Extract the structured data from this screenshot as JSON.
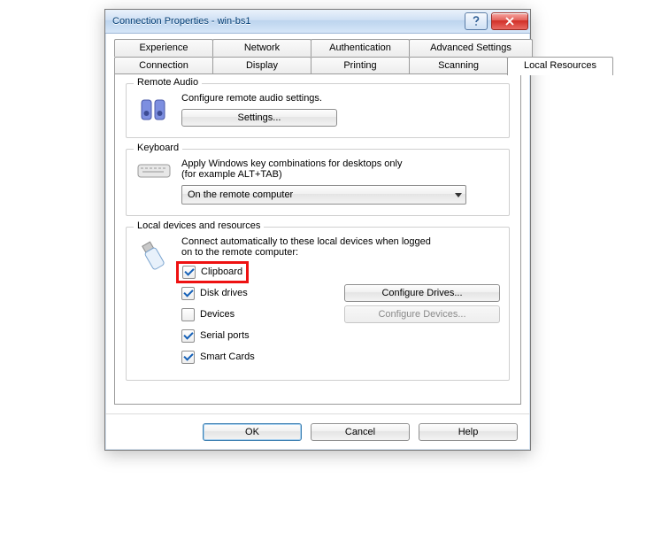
{
  "window": {
    "title": "Connection Properties - win-bs1"
  },
  "tabs": {
    "row1": [
      "Experience",
      "Network",
      "Authentication",
      "Advanced Settings"
    ],
    "row2": [
      "Connection",
      "Display",
      "Printing",
      "Scanning",
      "Local Resources"
    ]
  },
  "audio": {
    "title": "Remote Audio",
    "desc": "Configure remote audio settings.",
    "button": "Settings..."
  },
  "keyboard": {
    "title": "Keyboard",
    "desc1": "Apply Windows key combinations for desktops only",
    "desc2": "(for example ALT+TAB)",
    "value": "On the remote computer"
  },
  "devices": {
    "title": "Local devices and resources",
    "desc1": "Connect automatically to these local devices when logged",
    "desc2": "on to the remote computer:",
    "items": [
      {
        "label": "Clipboard",
        "checked": true
      },
      {
        "label": "Disk drives",
        "checked": true,
        "button": "Configure Drives..."
      },
      {
        "label": "Devices",
        "checked": false,
        "button": "Configure Devices..."
      },
      {
        "label": "Serial ports",
        "checked": true
      },
      {
        "label": "Smart Cards",
        "checked": true
      }
    ]
  },
  "footer": {
    "ok": "OK",
    "cancel": "Cancel",
    "help": "Help"
  }
}
